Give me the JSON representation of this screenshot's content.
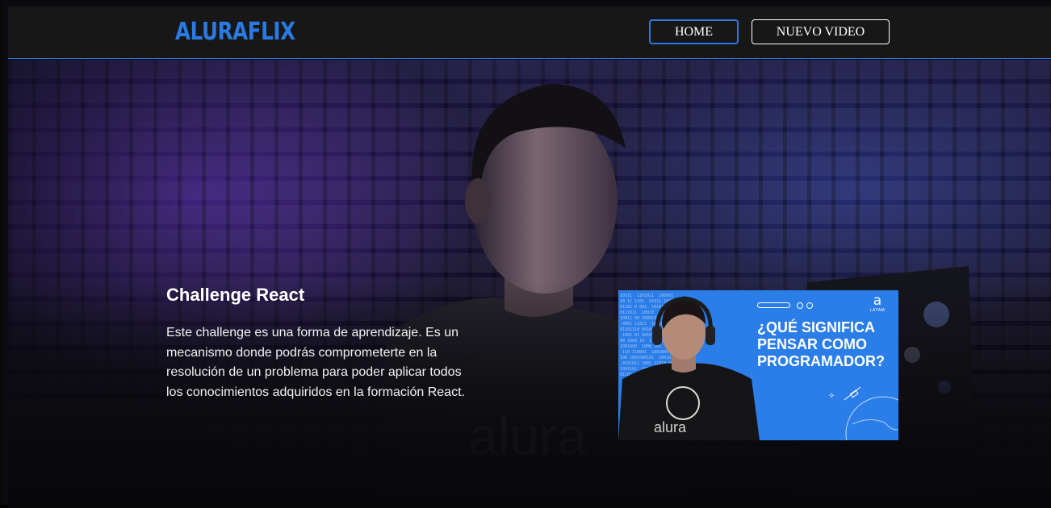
{
  "header": {
    "logo": "ALURAFLIX",
    "nav": {
      "home_label": "HOME",
      "new_video_label": "NUEVO VIDEO"
    }
  },
  "hero": {
    "title": "Challenge React",
    "description": "Este challenge es una forma de aprendizaje. Es un mecanismo donde podrás comprometerte en la resolución de un problema para poder aplicar todos los conocimientos adquiridos en la formación React.",
    "shirt_text": "alura"
  },
  "video_card": {
    "headline": "¿QUÉ SIGNIFICA\nPENSAR COMO\nPROGRAMADOR?",
    "brand_mark": "a",
    "brand_label": "LATAM",
    "shirt_text": "alura",
    "code_bg": "10111  1101011  100001\n10 11 1101  01011 1010011\n01101 0 001  1010111 00\n0111011  10010  0001011\n10011 00 1000101 11000\n 0001 11011  1001010 1\n01101110 0010 101 1100\n 1001 01 00101  0101011\n00 1000 10  110100 1\n1001000  1000 101  0101\n 110 110001  1001000 0\n100 1001000101  1001011\n 0101011 1001 11010 001\n1001101  00100 1000001\n01101 0100 1110 0101 11"
  },
  "colors": {
    "accent": "#2a7ae2",
    "header_bg": "#171717",
    "card_bg": "#2b7de8"
  }
}
